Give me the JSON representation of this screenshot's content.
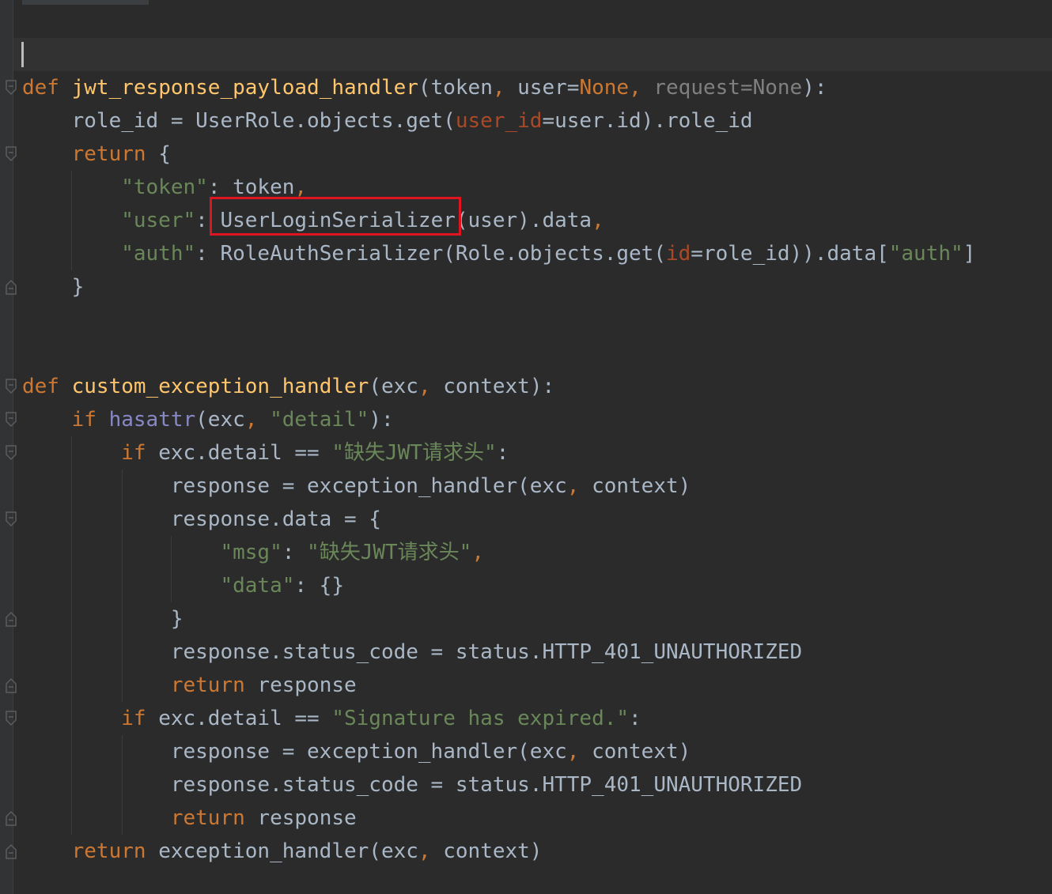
{
  "editor": {
    "lines": [
      [
        [
          "kw",
          "def "
        ],
        [
          "fn",
          "jwt_response_payload_handler"
        ],
        [
          "txt",
          "(token"
        ],
        [
          "pk",
          ", "
        ],
        [
          "txt",
          "user="
        ],
        [
          "pk",
          "None"
        ],
        [
          "pk",
          ", "
        ],
        [
          "gray",
          "request=None"
        ],
        [
          "txt",
          "):"
        ]
      ],
      [
        [
          "txt",
          "    role_id = UserRole.objects.get("
        ],
        [
          "param",
          "user_id"
        ],
        [
          "txt",
          "=user.id).role_id"
        ]
      ],
      [
        [
          "kw",
          "    return "
        ],
        [
          "txt",
          "{"
        ]
      ],
      [
        [
          "str",
          "        \"token\""
        ],
        [
          "txt",
          ": token"
        ],
        [
          "pk",
          ","
        ]
      ],
      [
        [
          "str",
          "        \"user\""
        ],
        [
          "txt",
          ": UserLoginSerializer(user).data"
        ],
        [
          "pk",
          ","
        ]
      ],
      [
        [
          "str",
          "        \"auth\""
        ],
        [
          "txt",
          ": RoleAuthSerializer(Role.objects.get("
        ],
        [
          "param",
          "id"
        ],
        [
          "txt",
          "=role_id)).data["
        ],
        [
          "str",
          "\"auth\""
        ],
        [
          "txt",
          "]"
        ]
      ],
      [
        [
          "txt",
          "    }"
        ]
      ],
      [
        [
          "txt",
          ""
        ]
      ],
      [
        [
          "txt",
          ""
        ]
      ],
      [
        [
          "kw",
          "def "
        ],
        [
          "fn",
          "custom_exception_handler"
        ],
        [
          "txt",
          "(exc"
        ],
        [
          "pk",
          ", "
        ],
        [
          "txt",
          "context):"
        ]
      ],
      [
        [
          "kw",
          "    if "
        ],
        [
          "builtin",
          "hasattr"
        ],
        [
          "txt",
          "(exc"
        ],
        [
          "pk",
          ", "
        ],
        [
          "str",
          "\"detail\""
        ],
        [
          "txt",
          "):"
        ]
      ],
      [
        [
          "kw",
          "        if "
        ],
        [
          "txt",
          "exc.detail == "
        ],
        [
          "str",
          "\"缺失JWT请求头\""
        ],
        [
          "txt",
          ":"
        ]
      ],
      [
        [
          "txt",
          "            response = exception_handler(exc"
        ],
        [
          "pk",
          ", "
        ],
        [
          "txt",
          "context)"
        ]
      ],
      [
        [
          "txt",
          "            response.data = {"
        ]
      ],
      [
        [
          "str",
          "                \"msg\""
        ],
        [
          "txt",
          ": "
        ],
        [
          "str",
          "\"缺失JWT请求头\""
        ],
        [
          "pk",
          ","
        ]
      ],
      [
        [
          "str",
          "                \"data\""
        ],
        [
          "txt",
          ": {}"
        ]
      ],
      [
        [
          "txt",
          "            }"
        ]
      ],
      [
        [
          "txt",
          "            response.status_code = status.HTTP_401_UNAUTHORIZED"
        ]
      ],
      [
        [
          "kw",
          "            return "
        ],
        [
          "txt",
          "response"
        ]
      ],
      [
        [
          "kw",
          "        if "
        ],
        [
          "txt",
          "exc.detail == "
        ],
        [
          "str",
          "\"Signature has expired.\""
        ],
        [
          "txt",
          ":"
        ]
      ],
      [
        [
          "txt",
          "            response = exception_handler(exc"
        ],
        [
          "pk",
          ", "
        ],
        [
          "txt",
          "context)"
        ]
      ],
      [
        [
          "txt",
          "            response.status_code = status.HTTP_401_UNAUTHORIZED"
        ]
      ],
      [
        [
          "kw",
          "            return "
        ],
        [
          "txt",
          "response"
        ]
      ],
      [
        [
          "kw",
          "    return "
        ],
        [
          "txt",
          "exception_handler(exc"
        ],
        [
          "pk",
          ", "
        ],
        [
          "txt",
          "context)"
        ]
      ]
    ]
  },
  "colors": {
    "background": "#2b2b2b",
    "keyword": "#cc7832",
    "function": "#ffc66d",
    "string": "#6a8759",
    "param": "#aa4926",
    "builtin": "#8888c6",
    "text": "#a9b7c6",
    "highlight_box": "#e0141e"
  }
}
